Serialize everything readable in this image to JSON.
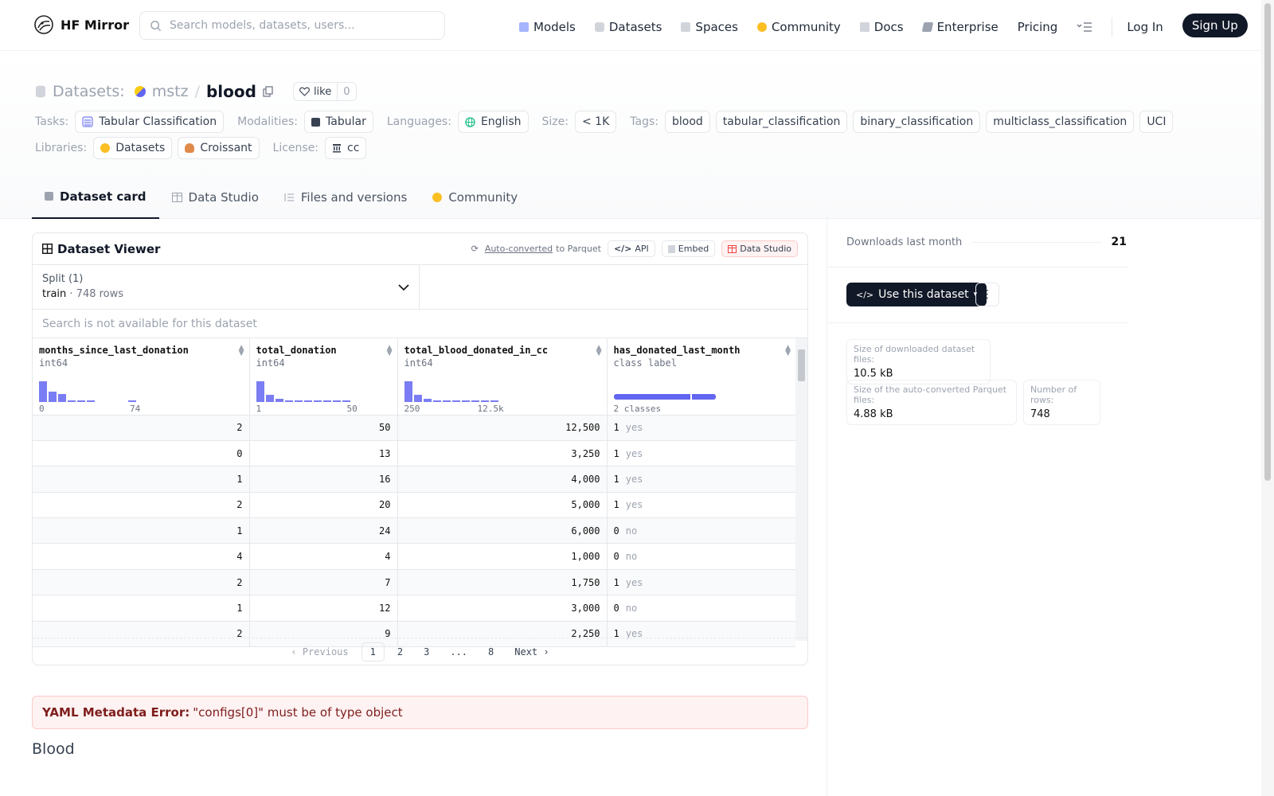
{
  "nav": {
    "brand": "HF Mirror",
    "search_placeholder": "Search models, datasets, users...",
    "links": [
      "Models",
      "Datasets",
      "Spaces",
      "Community",
      "Docs",
      "Enterprise",
      "Pricing"
    ],
    "login": "Log In",
    "signup": "Sign Up"
  },
  "header": {
    "prefix": "Datasets:",
    "org": "mstz",
    "slash": "/",
    "repo": "blood",
    "like_label": "like",
    "like_count": "0",
    "tasks_label": "Tasks:",
    "task": "Tabular Classification",
    "modalities_label": "Modalities:",
    "modality": "Tabular",
    "languages_label": "Languages:",
    "language": "English",
    "size_label": "Size:",
    "size": "< 1K",
    "tags_label": "Tags:",
    "tags": [
      "blood",
      "tabular_classification",
      "binary_classification",
      "multiclass_classification",
      "UCI"
    ],
    "libraries_label": "Libraries:",
    "libraries": [
      "Datasets",
      "Croissant"
    ],
    "license_label": "License:",
    "license": "cc"
  },
  "tabs": [
    "Dataset card",
    "Data Studio",
    "Files and versions",
    "Community"
  ],
  "viewer": {
    "title": "Dataset Viewer",
    "auto_converted": "Auto-converted",
    "to_parquet": "to Parquet",
    "api": "API",
    "embed": "Embed",
    "data_studio": "Data Studio",
    "split_label": "Split (1)",
    "split_name": "train",
    "split_rows": "748 rows",
    "search_disabled": "Search is not available for this dataset",
    "columns": [
      {
        "name": "months_since_last_donation",
        "type": "int64",
        "min": "0",
        "max": "74"
      },
      {
        "name": "total_donation",
        "type": "int64",
        "min": "1",
        "max": "50"
      },
      {
        "name": "total_blood_donated_in_cc",
        "type": "int64",
        "min": "250",
        "max": "12.5k"
      },
      {
        "name": "has_donated_last_month",
        "type": "class label",
        "min": "2 classes",
        "max": ""
      }
    ],
    "rows": [
      [
        "2",
        "50",
        "12,500",
        "1",
        "yes"
      ],
      [
        "0",
        "13",
        "3,250",
        "1",
        "yes"
      ],
      [
        "1",
        "16",
        "4,000",
        "1",
        "yes"
      ],
      [
        "2",
        "20",
        "5,000",
        "1",
        "yes"
      ],
      [
        "1",
        "24",
        "6,000",
        "0",
        "no"
      ],
      [
        "4",
        "4",
        "1,000",
        "0",
        "no"
      ],
      [
        "2",
        "7",
        "1,750",
        "1",
        "yes"
      ],
      [
        "1",
        "12",
        "3,000",
        "0",
        "no"
      ],
      [
        "2",
        "9",
        "2,250",
        "1",
        "yes"
      ]
    ],
    "pager": {
      "prev": "Previous",
      "pages": [
        "1",
        "2",
        "3",
        "...",
        "8"
      ],
      "next": "Next"
    }
  },
  "yaml_error": {
    "label": "YAML Metadata Error:",
    "message": "\"configs[0]\" must be of type object"
  },
  "card_heading": "Blood",
  "sidebar": {
    "downloads_label": "Downloads last month",
    "downloads_value": "21",
    "use_button": "Use this dataset",
    "size_files_label": "Size of downloaded dataset files:",
    "size_files_value": "10.5 kB",
    "parquet_label": "Size of the auto-converted Parquet files:",
    "parquet_value": "4.88 kB",
    "rows_label": "Number of rows:",
    "rows_value": "748"
  }
}
